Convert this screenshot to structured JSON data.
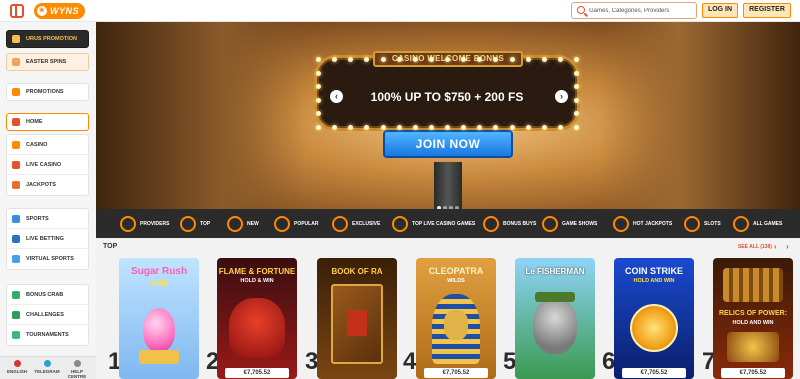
{
  "header": {
    "logo_text": "WYNS",
    "search_placeholder": "Games, Categories, Providers",
    "login_label": "LOG IN",
    "register_label": "REGISTER"
  },
  "sidebar": {
    "promo_label": "URUS PROMOTION",
    "easter_label": "EASTER SPINS",
    "promotions_label": "PROMOTIONS",
    "home_label": "HOME",
    "group1": [
      "CASINO",
      "LIVE CASINO",
      "JACKPOTS"
    ],
    "group2": [
      "SPORTS",
      "LIVE BETTING",
      "VIRTUAL SPORTS"
    ],
    "group3": [
      "BONUS CRAB",
      "CHALLENGES",
      "TOURNAMENTS"
    ],
    "footer": [
      "ENGLISH",
      "TELEGRAM",
      "HELP CENTRE"
    ]
  },
  "hero": {
    "sign_title": "CASINO WELCOME BONUS",
    "headline": "100% UP TO $750 + 200 FS",
    "cta": "JOIN NOW",
    "prev": "‹",
    "next": "›"
  },
  "categories": [
    "PROVIDERS",
    "TOP",
    "NEW",
    "POPULAR",
    "EXCLUSIVE",
    "TOP LIVE CASINO GAMES",
    "BONUS BUYS",
    "GAME SHOWS",
    "HOT JACKPOTS",
    "SLOTS",
    "ALL GAMES"
  ],
  "top": {
    "title": "TOP",
    "see_all": "SEE ALL (138)",
    "prev": "‹",
    "next": "›",
    "games": [
      {
        "rank": "1",
        "name": "Sugar Rush",
        "sub": "1000",
        "jackpot": ""
      },
      {
        "rank": "2",
        "name": "FLAME & FORTUNE",
        "sub": "HOLD & WIN",
        "jackpot": "€7,705.52"
      },
      {
        "rank": "3",
        "name": "BOOK OF RA",
        "sub": "",
        "jackpot": ""
      },
      {
        "rank": "4",
        "name": "CLEOPATRA",
        "sub": "WILDS",
        "jackpot": "€7,705.52"
      },
      {
        "rank": "5",
        "name": "Le FISHERMAN",
        "sub": "",
        "jackpot": ""
      },
      {
        "rank": "6",
        "name": "COIN STRIKE",
        "sub": "HOLD AND WIN",
        "jackpot": "€7,705.52"
      },
      {
        "rank": "7",
        "name": "RELICS OF POWER:",
        "sub": "HOLD AND WIN",
        "jackpot": "€7,705.52"
      }
    ]
  }
}
